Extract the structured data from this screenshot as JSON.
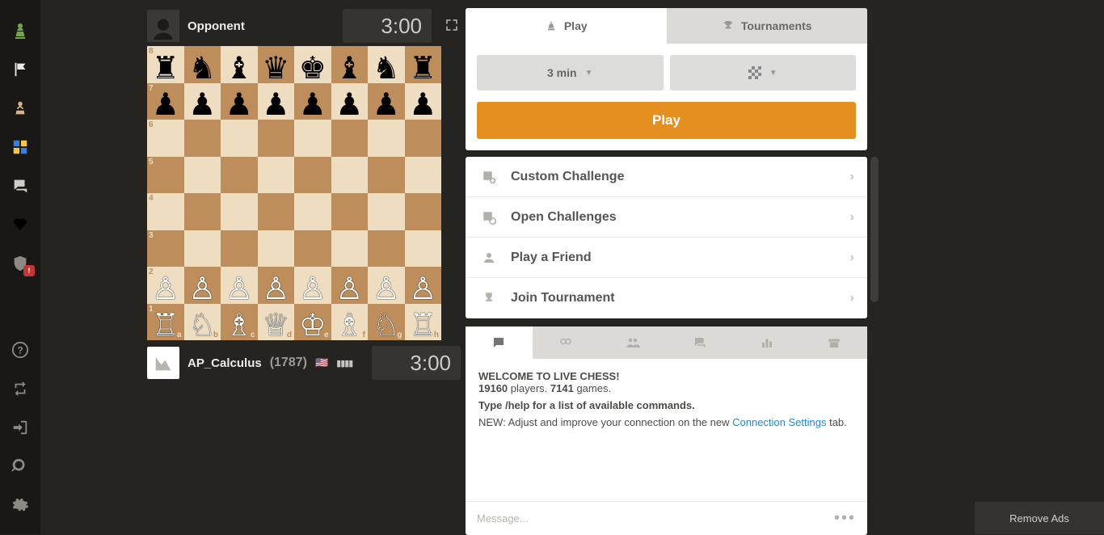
{
  "opponent": {
    "name": "Opponent",
    "clock": "3:00"
  },
  "player": {
    "name": "AP_Calculus",
    "rating": "(1787)",
    "flag": "🇺🇸",
    "signal": "▮▮▮▮",
    "clock": "3:00"
  },
  "board": {
    "ranks": [
      "8",
      "7",
      "6",
      "5",
      "4",
      "3",
      "2",
      "1"
    ],
    "files": [
      "a",
      "b",
      "c",
      "d",
      "e",
      "f",
      "g",
      "h"
    ],
    "position": [
      [
        "r",
        "n",
        "b",
        "q",
        "k",
        "b",
        "n",
        "r"
      ],
      [
        "p",
        "p",
        "p",
        "p",
        "p",
        "p",
        "p",
        "p"
      ],
      [
        "",
        "",
        "",
        "",
        "",
        "",
        "",
        ""
      ],
      [
        "",
        "",
        "",
        "",
        "",
        "",
        "",
        ""
      ],
      [
        "",
        "",
        "",
        "",
        "",
        "",
        "",
        ""
      ],
      [
        "",
        "",
        "",
        "",
        "",
        "",
        "",
        ""
      ],
      [
        "P",
        "P",
        "P",
        "P",
        "P",
        "P",
        "P",
        "P"
      ],
      [
        "R",
        "N",
        "B",
        "Q",
        "K",
        "B",
        "N",
        "R"
      ]
    ]
  },
  "tabs": {
    "play": "Play",
    "tournaments": "Tournaments"
  },
  "time_control": "3 min",
  "play_button": "Play",
  "menu": {
    "custom": "Custom Challenge",
    "open": "Open Challenges",
    "friend": "Play a Friend",
    "join": "Join Tournament"
  },
  "chat": {
    "welcome": "WELCOME TO LIVE CHESS!",
    "players_count": "19160",
    "players_word": " players. ",
    "games_count": "7141",
    "games_word": " games.",
    "help_line": "Type /help for a list of available commands.",
    "new_prefix": "NEW: Adjust and improve your connection on the new ",
    "new_link": "Connection Settings",
    "new_suffix": " tab.",
    "placeholder": "Message..."
  },
  "remove_ads": "Remove Ads"
}
